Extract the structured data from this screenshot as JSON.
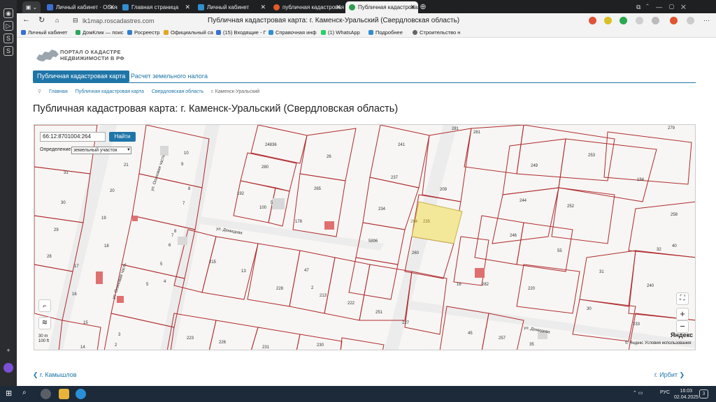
{
  "browser": {
    "tabs": [
      {
        "label": "Личный кабинет · Объяв",
        "color": "#3b6fd6"
      },
      {
        "label": "Главная страница",
        "color": "#2f8fd0"
      },
      {
        "label": "Личный кабинет",
        "color": "#2f8fd0"
      },
      {
        "label": "публичная кадастровая",
        "color": "#e55a2b"
      },
      {
        "label": "Публичная кадастровая",
        "color": "#2e9d4f"
      }
    ],
    "url": "lk1map.roscadastres.com",
    "page_title": "Публичная кадастровая карта: г. Каменск-Уральский (Свердловская область)",
    "bookmarks": [
      "Личный кабинет",
      "ДомКлик — поис",
      "Росреестр",
      "Официальный са",
      "(15) Входящие - Г",
      "Справочная инф",
      "(1) WhatsApp",
      "Подробнее",
      "Строительство н"
    ]
  },
  "site": {
    "logo_text": "ПОРТАЛ О КАДАСТРЕ\nНЕДВИЖИМОСТИ В РФ",
    "tabs": [
      "Публичная кадастровая карта",
      "Расчет земельного налога"
    ],
    "breadcrumbs": [
      "Главная",
      "Публичная кадастровая карта",
      "Свердловская область",
      "г. Каменск-Уральский"
    ],
    "heading": "Публичная кадастровая карта: г. Каменск-Уральский (Свердловская область)",
    "search_value": "66:12:8701004:264",
    "search_button": "Найти",
    "definition_label": "Определение",
    "definition_value": "земельный участок",
    "scale_text": "30 m\n100 ft",
    "yandex": "Яндекс",
    "copyright": "© Яндекс  Условия использования",
    "prev_city": "г. Камышлов",
    "next_city": "г. Ирбит"
  },
  "map_labels": {
    "streets": [
      "ул. Демидова",
      "ул. Демидова",
      "ул. Осиновая часть",
      "ул. Осиновая часть"
    ],
    "parcels": [
      "24836",
      "280",
      "265",
      "26",
      "192",
      "100",
      "5",
      "178",
      "241",
      "237",
      "209",
      "234",
      "264",
      "235",
      "5896",
      "260",
      "281",
      "281",
      "279",
      "249",
      "253",
      "184",
      "244",
      "252",
      "246",
      "55",
      "258",
      "32",
      "40",
      "31",
      "240",
      "220",
      "282",
      "16",
      "30",
      "233",
      "215",
      "13",
      "47",
      "228",
      "2",
      "213",
      "222",
      "251",
      "227",
      "45",
      "257",
      "35",
      "223",
      "226",
      "231",
      "230",
      "10",
      "9",
      "8",
      "7",
      "8",
      "7",
      "6",
      "5",
      "4",
      "5",
      "31",
      "21",
      "20",
      "30",
      "19",
      "29",
      "18",
      "28",
      "17",
      "16",
      "15",
      "14",
      "3",
      "2",
      "1",
      "1"
    ]
  },
  "taskbar": {
    "lang": "РУС",
    "time": "16:03",
    "date": "02.04.2025"
  }
}
